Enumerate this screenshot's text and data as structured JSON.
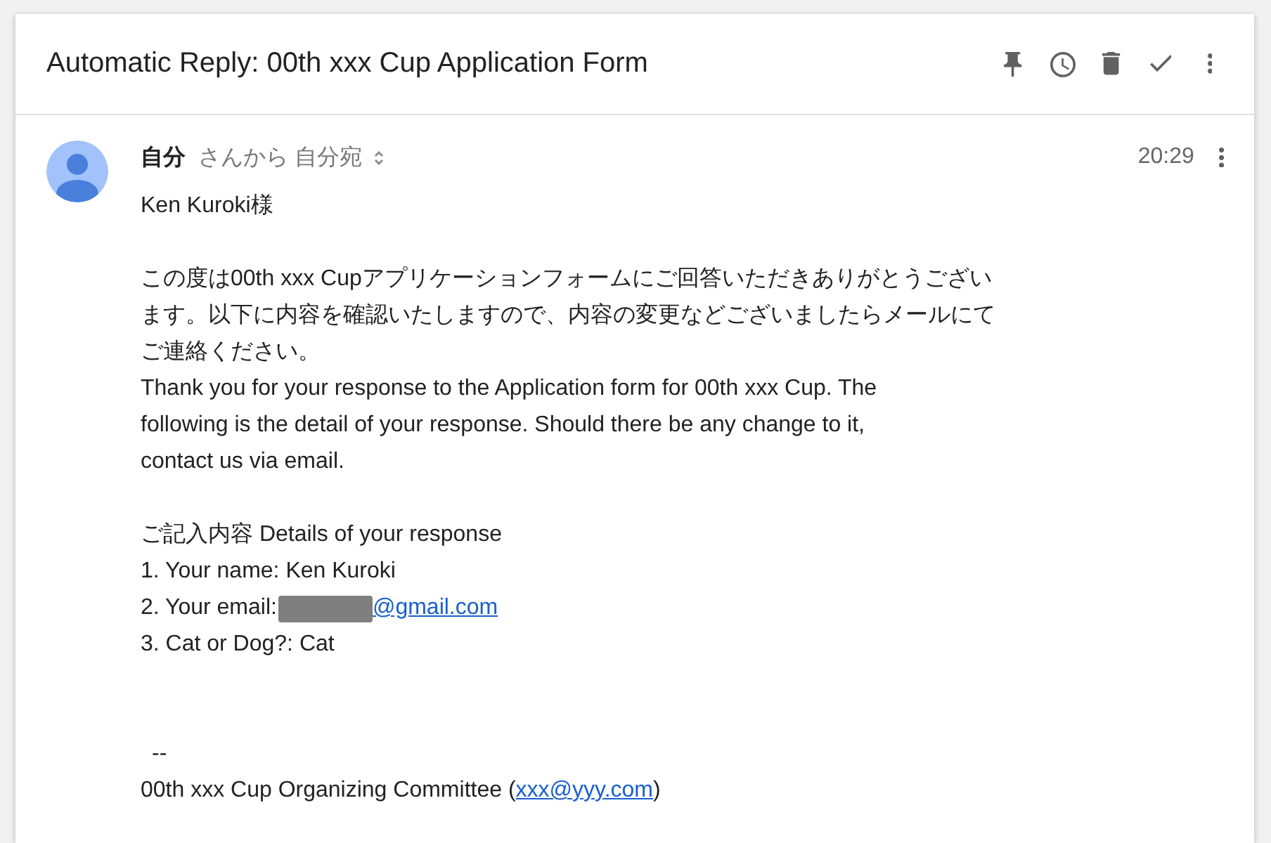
{
  "header": {
    "title": "Automatic Reply: 00th xxx Cup Application Form"
  },
  "message": {
    "sender": "自分",
    "recipient_text": "さんから 自分宛",
    "time": "20:29",
    "body": [
      {
        "kind": "line",
        "text": "Ken Kuroki様"
      },
      {
        "kind": "blank"
      },
      {
        "kind": "paragraph",
        "lines": [
          "この度は00th xxx Cupアプリケーションフォームにご回答いただきありがとうござい",
          "ます。以下に内容を確認いたしますので、内容の変更などございましたらメールにて",
          "ご連絡ください。"
        ]
      },
      {
        "kind": "paragraph",
        "lines": [
          "Thank you for your response to the Application form for 00th xxx Cup. The",
          "following is the detail of your response. Should there be any change to it,",
          "contact us via email."
        ]
      },
      {
        "kind": "blank"
      },
      {
        "kind": "line",
        "text": "ご記入内容 Details of your response"
      },
      {
        "kind": "line",
        "text": "1. Your name: Ken Kuroki"
      },
      {
        "kind": "email_line",
        "label": "2. Your email:",
        "redacted": true,
        "link": "@gmail.com"
      },
      {
        "kind": "line",
        "text": "3. Cat or Dog?: Cat"
      },
      {
        "kind": "blank"
      },
      {
        "kind": "blank"
      },
      {
        "kind": "separator",
        "text": "--"
      },
      {
        "kind": "link_line",
        "before": "00th xxx Cup Organizing Committee (",
        "link": "xxx@yyy.com",
        "after": ")"
      }
    ]
  }
}
